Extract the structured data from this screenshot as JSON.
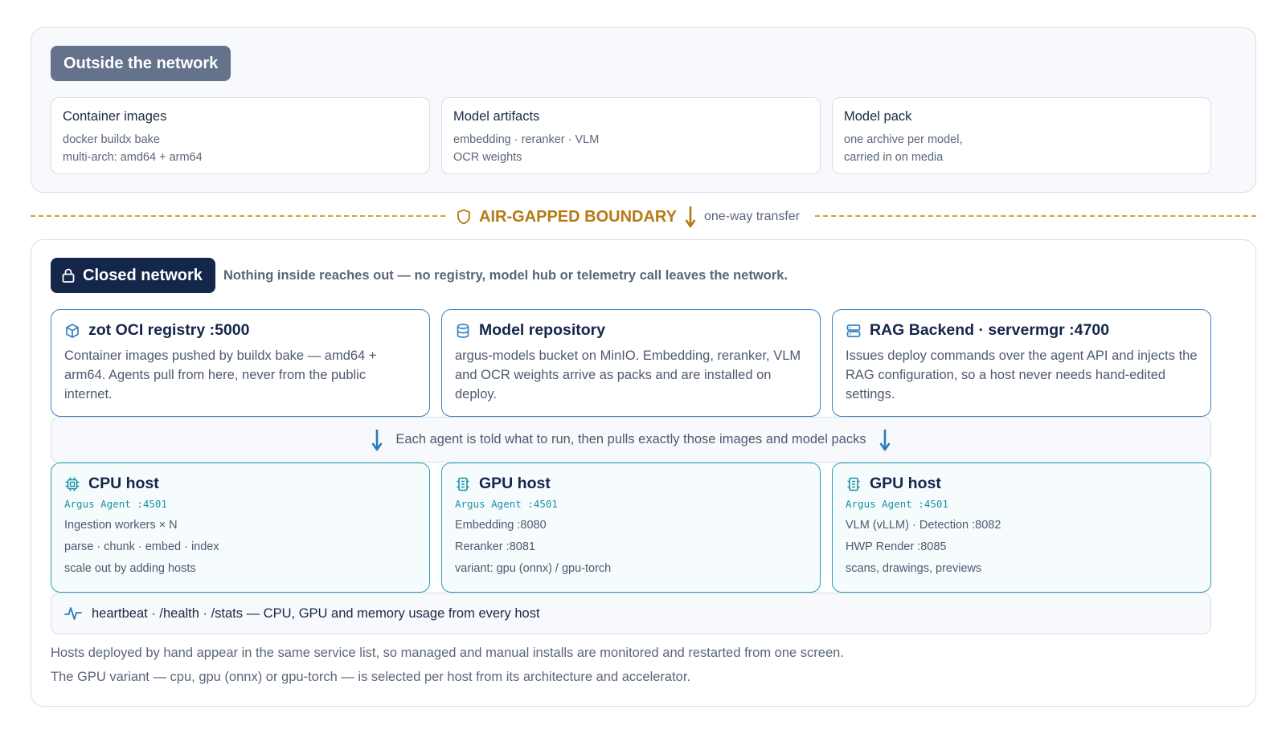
{
  "outside": {
    "badge": "Outside the network",
    "cards": [
      {
        "title": "Container images",
        "lines": [
          "docker buildx bake",
          "multi-arch: amd64 + arm64"
        ]
      },
      {
        "title": "Model artifacts",
        "lines": [
          "embedding · reranker · VLM",
          "OCR weights"
        ]
      },
      {
        "title": "Model pack",
        "lines": [
          "one archive per model,",
          "carried in on media"
        ]
      }
    ]
  },
  "boundary": {
    "title": "AIR-GAPPED BOUNDARY",
    "sub": "one-way transfer",
    "icons": {
      "shield": "shield-icon",
      "arrow": "arrow-down-icon"
    }
  },
  "closed": {
    "badge": "Closed network",
    "note": "Nothing inside reaches out — no registry, model hub or telemetry call leaves the network.",
    "services": [
      {
        "icon": "package-icon",
        "title": "zot OCI registry :5000",
        "desc": "Container images pushed by buildx bake — amd64 + arm64. Agents pull from here, never from the public internet."
      },
      {
        "icon": "database-icon",
        "title": "Model repository",
        "desc": "argus-models bucket on MinIO. Embedding, reranker, VLM and OCR weights arrive as packs and are installed on deploy."
      },
      {
        "icon": "server-icon",
        "title": "RAG Backend · servermgr :4700",
        "desc": "Issues deploy commands over the agent API and injects the RAG configuration, so a host never needs hand-edited settings."
      }
    ],
    "flow": "Each agent is told what to run, then pulls exactly those images and model packs",
    "hosts": [
      {
        "icon": "cpu-icon",
        "title": "CPU host",
        "agent": "Argus Agent :4501",
        "lines": [
          "Ingestion workers × N",
          "parse · chunk · embed · index",
          "scale out by adding hosts"
        ]
      },
      {
        "icon": "gpu-icon",
        "title": "GPU host",
        "agent": "Argus Agent :4501",
        "lines": [
          "Embedding :8080",
          "Reranker :8081",
          "variant: gpu (onnx) / gpu-torch"
        ]
      },
      {
        "icon": "gpu-icon",
        "title": "GPU host",
        "agent": "Argus Agent :4501",
        "lines": [
          "VLM (vLLM) · Detection :8082",
          "HWP Render :8085",
          "scans, drawings, previews"
        ]
      }
    ],
    "heartbeat": "heartbeat · /health · /stats — CPU, GPU and memory usage from every host",
    "footnotes": [
      "Hosts deployed by hand appear in the same service list, so managed and manual installs are monitored and restarted from one screen.",
      "The GPU variant — cpu, gpu (onnx) or gpu-torch — is selected per host from its architecture and accelerator."
    ]
  },
  "colors": {
    "navy": "#14264a",
    "slate": "#64728c",
    "amber": "#b47a15",
    "service_border": "#3a82c4",
    "host_border": "#2aa0b3"
  }
}
